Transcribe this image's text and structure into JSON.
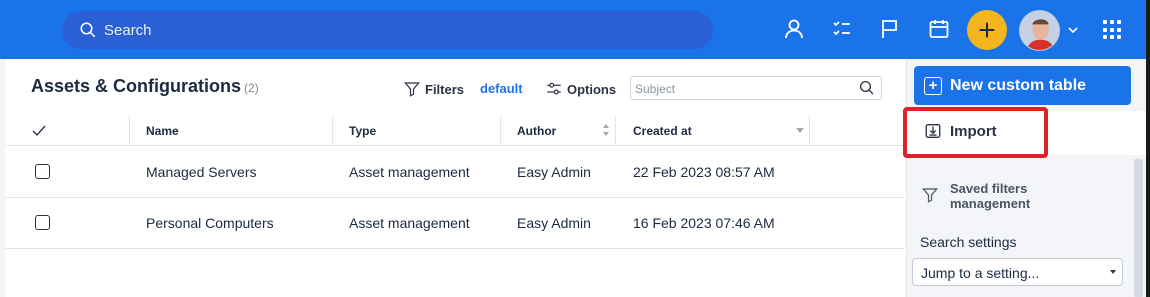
{
  "topbar": {
    "search_placeholder": "Search",
    "icons": [
      "search-icon",
      "user-icon",
      "tasks-icon",
      "flag-icon",
      "calendar-icon",
      "plus-icon",
      "avatar",
      "chevron-down-icon",
      "apps-grid-icon"
    ],
    "accent": "#1a73e8",
    "plus_color": "#f4b61c"
  },
  "page": {
    "title": "Assets & Configurations",
    "count": "(2)",
    "filters_label": "Filters",
    "default_label": "default",
    "options_label": "Options",
    "subject_placeholder": "Subject"
  },
  "table": {
    "columns": [
      "Name",
      "Type",
      "Author",
      "Created at"
    ],
    "rows": [
      {
        "name": "Managed Servers",
        "type": "Asset management",
        "author": "Easy Admin",
        "created": "22 Feb 2023 08:57 AM"
      },
      {
        "name": "Personal Computers",
        "type": "Asset management",
        "author": "Easy Admin",
        "created": "16 Feb 2023 07:46 AM"
      }
    ]
  },
  "sidebar": {
    "new_button": "New custom table",
    "import_label": "Import",
    "saved_filters": "Saved filters management",
    "search_settings": "Search settings",
    "jump_placeholder": "Jump to a setting..."
  }
}
